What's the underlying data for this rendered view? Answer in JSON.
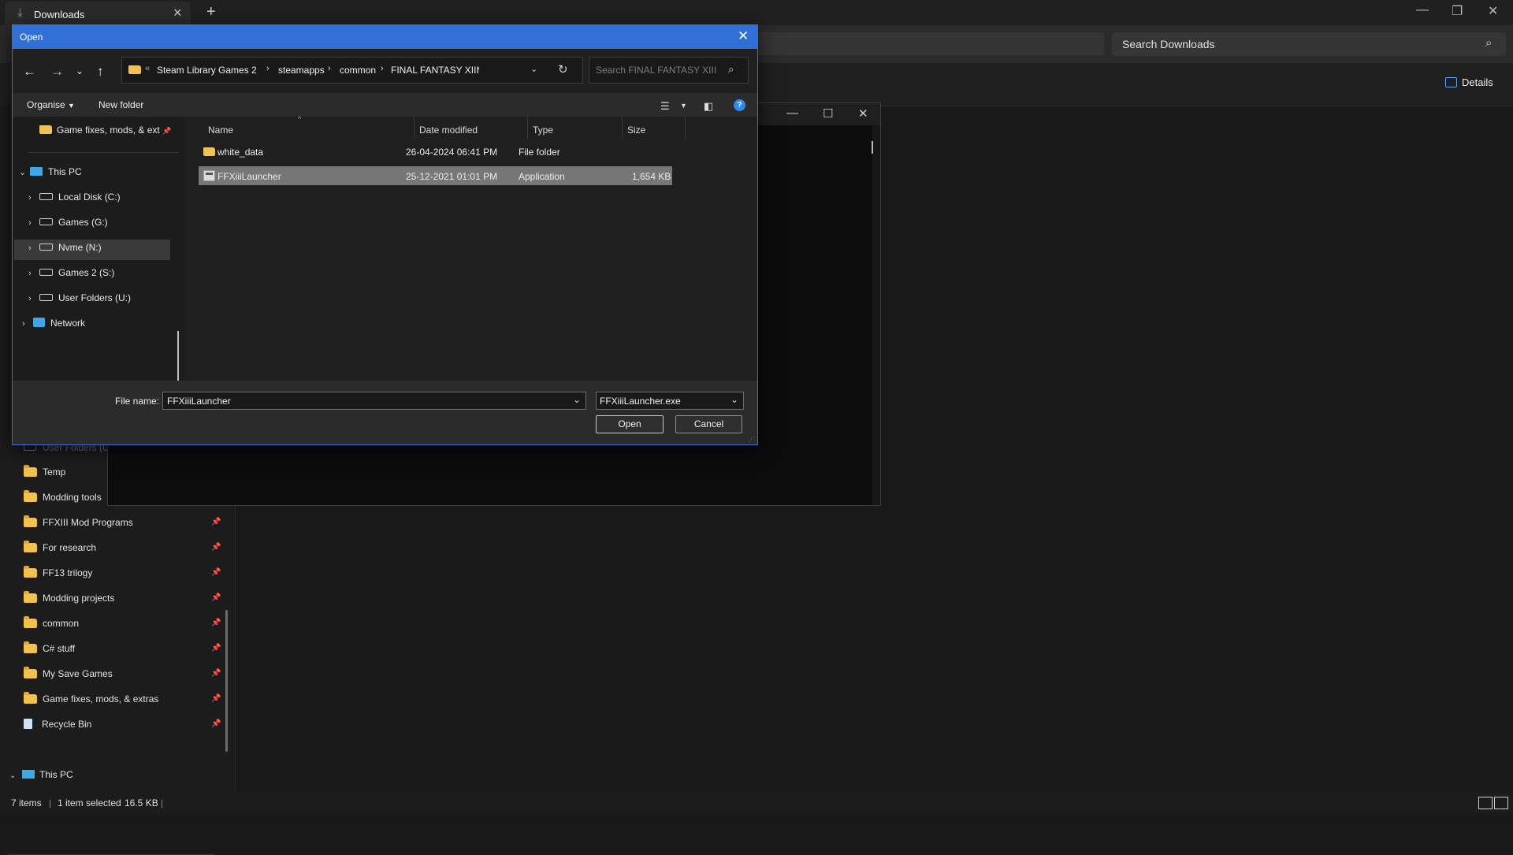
{
  "tab": {
    "title": "Downloads"
  },
  "window_controls": {
    "min": "—",
    "max": "❐",
    "close": "✕"
  },
  "explorer": {
    "search_placeholder": "Search Downloads",
    "details_label": "Details",
    "nav_items": [
      {
        "label": "User Folders (U:)",
        "pinned": false,
        "dim": true
      },
      {
        "label": "Temp",
        "pinned": false
      },
      {
        "label": "Modding tools",
        "pinned": false
      },
      {
        "label": "FFXIII Mod Programs",
        "pinned": true
      },
      {
        "label": "For research",
        "pinned": true
      },
      {
        "label": "FF13 trilogy",
        "pinned": true
      },
      {
        "label": "Modding projects",
        "pinned": true
      },
      {
        "label": "common",
        "pinned": true
      },
      {
        "label": "C# stuff",
        "pinned": true
      },
      {
        "label": "My Save Games",
        "pinned": true
      },
      {
        "label": "Game fixes, mods, & extras",
        "pinned": true
      },
      {
        "label": "Recycle Bin",
        "pinned": true
      }
    ],
    "this_pc_label": "This PC",
    "status": {
      "items": "7 items",
      "selected": "1 item selected",
      "size": "16.5 KB"
    }
  },
  "dialog": {
    "title": "Open",
    "breadcrumb": [
      "Steam Library Games 2",
      "steamapps",
      "common",
      "FINAL FANTASY XIII"
    ],
    "search_placeholder": "Search FINAL FANTASY XIII",
    "organise_label": "Organise",
    "new_folder_label": "New folder",
    "left_pane": {
      "quick_item": "Game fixes, mods, & ext",
      "this_pc": "This PC",
      "drives": [
        "Local Disk (C:)",
        "Games (G:)",
        "Nvme (N:)",
        "Games 2 (S:)",
        "User Folders (U:)"
      ],
      "network": "Network"
    },
    "columns": [
      "Name",
      "Date modified",
      "Type",
      "Size"
    ],
    "files": [
      {
        "name": "white_data",
        "date": "26-04-2024 06:41 PM",
        "type": "File folder",
        "size": "",
        "kind": "folder",
        "selected": false
      },
      {
        "name": "FFXiiiLauncher",
        "date": "25-12-2021 01:01 PM",
        "type": "Application",
        "size": "1,654 KB",
        "kind": "app",
        "selected": true
      }
    ],
    "file_name_label": "File name:",
    "file_name_value": "FFXiiiLauncher",
    "file_type_value": "FFXiiiLauncher.exe",
    "open_label": "Open",
    "cancel_label": "Cancel"
  }
}
